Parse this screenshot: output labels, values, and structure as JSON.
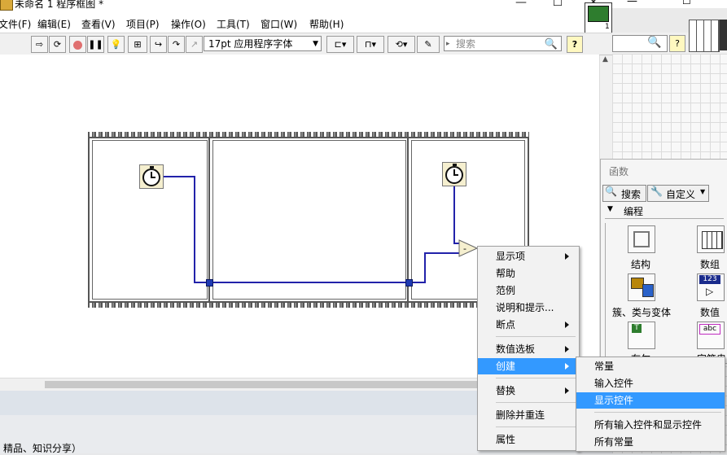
{
  "window": {
    "title": "未命名 1 程序框图 *",
    "min_symbol": "—",
    "max_symbol": "☐",
    "close_symbol": "✕"
  },
  "menubar": {
    "items": [
      "文件(F)",
      "编辑(E)",
      "查看(V)",
      "项目(P)",
      "操作(O)",
      "工具(T)",
      "窗口(W)",
      "帮助(H)"
    ]
  },
  "toolbar": {
    "font_select": "17pt 应用程序字体",
    "search_placeholder": "搜索",
    "help_label": "?"
  },
  "diagram": {
    "frames": 3,
    "subtract_symbol": "-"
  },
  "context_menu": {
    "items": [
      {
        "label": "显示项",
        "submenu": true
      },
      {
        "label": "帮助",
        "submenu": false
      },
      {
        "label": "范例",
        "submenu": false
      },
      {
        "label": "说明和提示...",
        "submenu": false
      },
      {
        "label": "断点",
        "submenu": true
      },
      {
        "label": "数值选板",
        "submenu": true
      },
      {
        "label": "创建",
        "submenu": true,
        "selected": true
      },
      {
        "label": "替换",
        "submenu": true
      },
      {
        "label": "删除并重连",
        "submenu": false
      },
      {
        "label": "属性",
        "submenu": false
      }
    ]
  },
  "create_submenu": {
    "items": [
      {
        "label": "常量",
        "selected": false
      },
      {
        "label": "输入控件",
        "selected": false
      },
      {
        "label": "显示控件",
        "selected": true
      },
      {
        "label": "所有输入控件和显示控件",
        "selected": false
      },
      {
        "label": "所有常量",
        "selected": false
      }
    ]
  },
  "palette": {
    "title": "函数",
    "search_button": "搜索",
    "custom_button": "自定义",
    "category": "编程",
    "items": [
      "结构",
      "数组",
      "簇、类与变体",
      "数值",
      "布尔",
      "字符串"
    ],
    "icon_labels": {
      "numeric": "123",
      "string": "abc",
      "bool": "T"
    }
  },
  "bottom": {
    "text": "精品、知识分享）"
  },
  "colors": {
    "selection": "#3399ff",
    "wire": "#2222aa",
    "tunnel": "#1f3ab2"
  }
}
